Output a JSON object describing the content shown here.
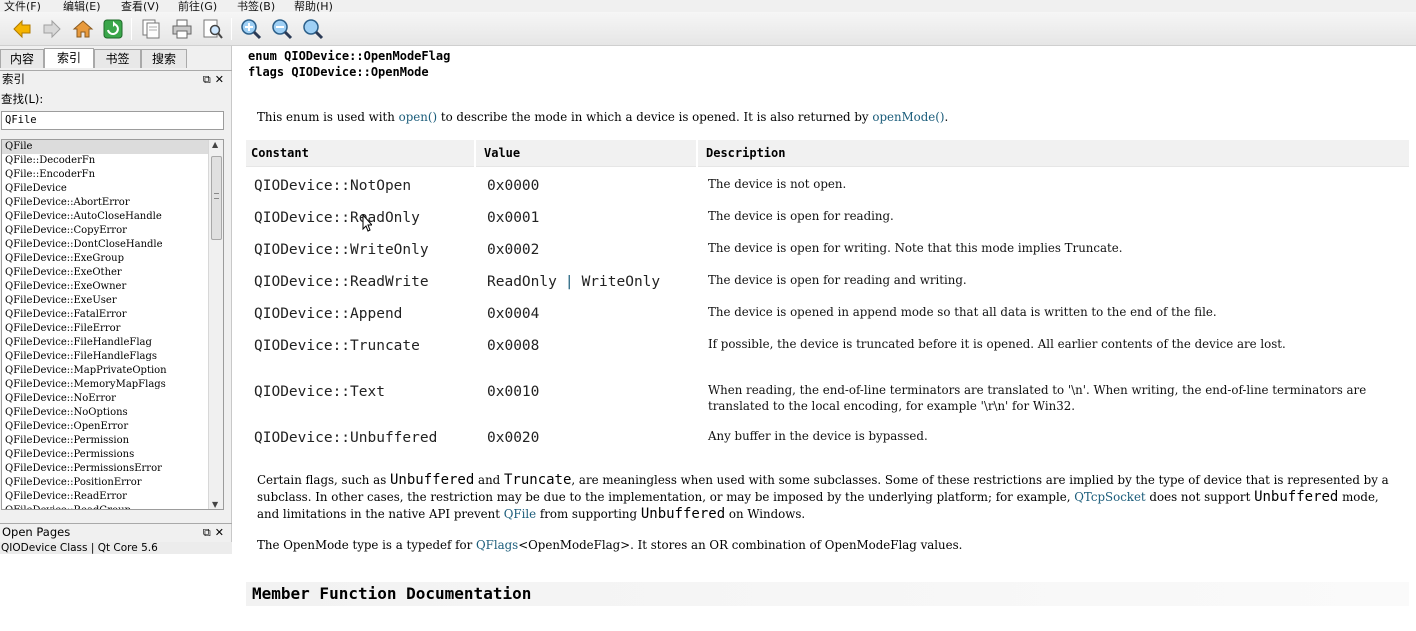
{
  "menu": [
    "文件(F)",
    "编辑(E)",
    "查看(V)",
    "前往(G)",
    "书签(B)",
    "帮助(H)"
  ],
  "sidebar": {
    "tabs": [
      "内容",
      "索引",
      "书签",
      "搜索"
    ],
    "index_dock_title": "索引",
    "find_label": "查找(L):",
    "find_value": "QFile",
    "index_items": [
      "QFile",
      "QFile::DecoderFn",
      "QFile::EncoderFn",
      "QFileDevice",
      "QFileDevice::AbortError",
      "QFileDevice::AutoCloseHandle",
      "QFileDevice::CopyError",
      "QFileDevice::DontCloseHandle",
      "QFileDevice::ExeGroup",
      "QFileDevice::ExeOther",
      "QFileDevice::ExeOwner",
      "QFileDevice::ExeUser",
      "QFileDevice::FatalError",
      "QFileDevice::FileError",
      "QFileDevice::FileHandleFlag",
      "QFileDevice::FileHandleFlags",
      "QFileDevice::MapPrivateOption",
      "QFileDevice::MemoryMapFlags",
      "QFileDevice::NoError",
      "QFileDevice::NoOptions",
      "QFileDevice::OpenError",
      "QFileDevice::Permission",
      "QFileDevice::Permissions",
      "QFileDevice::PermissionsError",
      "QFileDevice::PositionError",
      "QFileDevice::ReadError",
      "QFileDevice::ReadGroup"
    ],
    "open_pages_title": "Open Pages",
    "open_pages": [
      "QIODevice Class | Qt Core 5.6"
    ]
  },
  "doc": {
    "enum_line": "enum QIODevice::OpenModeFlag",
    "flags_line": "flags QIODevice::OpenMode",
    "intro": {
      "t1": "This enum is used with ",
      "link1": "open()",
      "t2": " to describe the mode in which a device is opened. It is also returned by ",
      "link2": "openMode()",
      "t3": "."
    },
    "table_headers": [
      "Constant",
      "Value",
      "Description"
    ],
    "rows": [
      {
        "constant": "QIODevice::NotOpen",
        "value": "0x0000",
        "desc": "The device is not open."
      },
      {
        "constant": "QIODevice::ReadOnly",
        "value": "0x0001",
        "desc": "The device is open for reading."
      },
      {
        "constant": "QIODevice::WriteOnly",
        "value": "0x0002",
        "desc": "The device is open for writing. Note that this mode implies Truncate."
      },
      {
        "constant": "QIODevice::ReadWrite",
        "value_a": "ReadOnly",
        "value_sep": "|",
        "value_b": "WriteOnly",
        "desc": "The device is open for reading and writing."
      },
      {
        "constant": "QIODevice::Append",
        "value": "0x0004",
        "desc": "The device is opened in append mode so that all data is written to the end of the file."
      },
      {
        "constant": "QIODevice::Truncate",
        "value": "0x0008",
        "desc": "If possible, the device is truncated before it is opened. All earlier contents of the device are lost."
      },
      {
        "constant": "QIODevice::Text",
        "value": "0x0010",
        "desc": "When reading, the end-of-line terminators are translated to '\\n'. When writing, the end-of-line terminators are translated to the local encoding, for example '\\r\\n' for Win32."
      },
      {
        "constant": "QIODevice::Unbuffered",
        "value": "0x0020",
        "desc": "Any buffer in the device is bypassed."
      }
    ],
    "note": {
      "t1": "Certain flags, such as ",
      "m1": "Unbuffered",
      "t2": " and ",
      "m2": "Truncate",
      "t3": ", are meaningless when used with some subclasses. Some of these restrictions are implied by the type of device that is represented by a subclass. In other cases, the restriction may be due to the implementation, or may be imposed by the underlying platform; for example, ",
      "link1": "QTcpSocket",
      "t4": " does not support ",
      "m3": "Unbuffered",
      "t5": " mode, and limitations in the native API prevent ",
      "link2": "QFile",
      "t6": " from supporting ",
      "m4": "Unbuffered",
      "t7": " on Windows."
    },
    "typedef": {
      "t1": "The OpenMode type is a typedef for ",
      "link1": "QFlags",
      "t2": "<OpenModeFlag>. It stores an OR combination of OpenModeFlag values."
    },
    "section_title": "Member Function Documentation"
  },
  "colors": {
    "link": "#1a5c7a",
    "table_header_bg": "#f1f1f1"
  },
  "icons": [
    "back-arrow-icon",
    "forward-arrow-icon",
    "home-icon",
    "sync-icon",
    "copy-icon",
    "print-icon",
    "find-icon",
    "zoom-in-icon",
    "zoom-out-icon",
    "zoom-reset-icon"
  ]
}
